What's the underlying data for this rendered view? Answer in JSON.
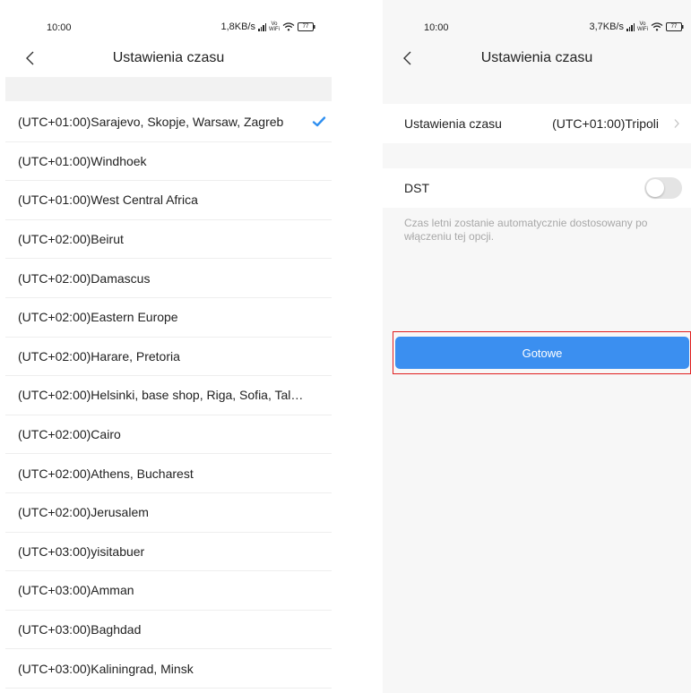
{
  "left_screen": {
    "status": {
      "time": "10:00",
      "speed": "1,8KB/s",
      "vo_top": "Vo",
      "vo_bottom": "WiFi",
      "battery": "77"
    },
    "title": "Ustawienia czasu",
    "timezones": [
      {
        "label": "(UTC+01:00)Sarajevo, Skopje, Warsaw, Zagreb",
        "selected": true
      },
      {
        "label": "(UTC+01:00)Windhoek"
      },
      {
        "label": "(UTC+01:00)West Central Africa"
      },
      {
        "label": "(UTC+02:00)Beirut"
      },
      {
        "label": "(UTC+02:00)Damascus"
      },
      {
        "label": "(UTC+02:00)Eastern Europe"
      },
      {
        "label": "(UTC+02:00)Harare, Pretoria"
      },
      {
        "label": "(UTC+02:00)Helsinki, base shop, Riga, Sofia, Tallin..."
      },
      {
        "label": "(UTC+02:00)Cairo"
      },
      {
        "label": "(UTC+02:00)Athens, Bucharest"
      },
      {
        "label": "(UTC+02:00)Jerusalem"
      },
      {
        "label": "(UTC+03:00)yisitabuer"
      },
      {
        "label": "(UTC+03:00)Amman"
      },
      {
        "label": "(UTC+03:00)Baghdad"
      },
      {
        "label": "(UTC+03:00)Kaliningrad, Minsk"
      }
    ],
    "colors": {
      "check": "#2f8ff0"
    },
    "icons": {
      "back": "chevron-left-icon",
      "selected": "checkmark-icon"
    }
  },
  "right_screen": {
    "status": {
      "time": "10:00",
      "speed": "3,7KB/s",
      "vo_top": "Vo",
      "vo_bottom": "WiFi",
      "battery": "77"
    },
    "title": "Ustawienia czasu",
    "time_setting": {
      "label": "Ustawienia czasu",
      "value": "(UTC+01:00)Tripoli"
    },
    "dst": {
      "label": "DST",
      "enabled": false,
      "note": "Czas letni zostanie automatycznie dostosowany po włączeniu tej opcji."
    },
    "done_button": "Gotowe",
    "colors": {
      "button": "#3b8ff0",
      "highlight": "#e02020"
    },
    "icons": {
      "back": "chevron-left-icon",
      "chevron": "chevron-right-icon"
    }
  }
}
